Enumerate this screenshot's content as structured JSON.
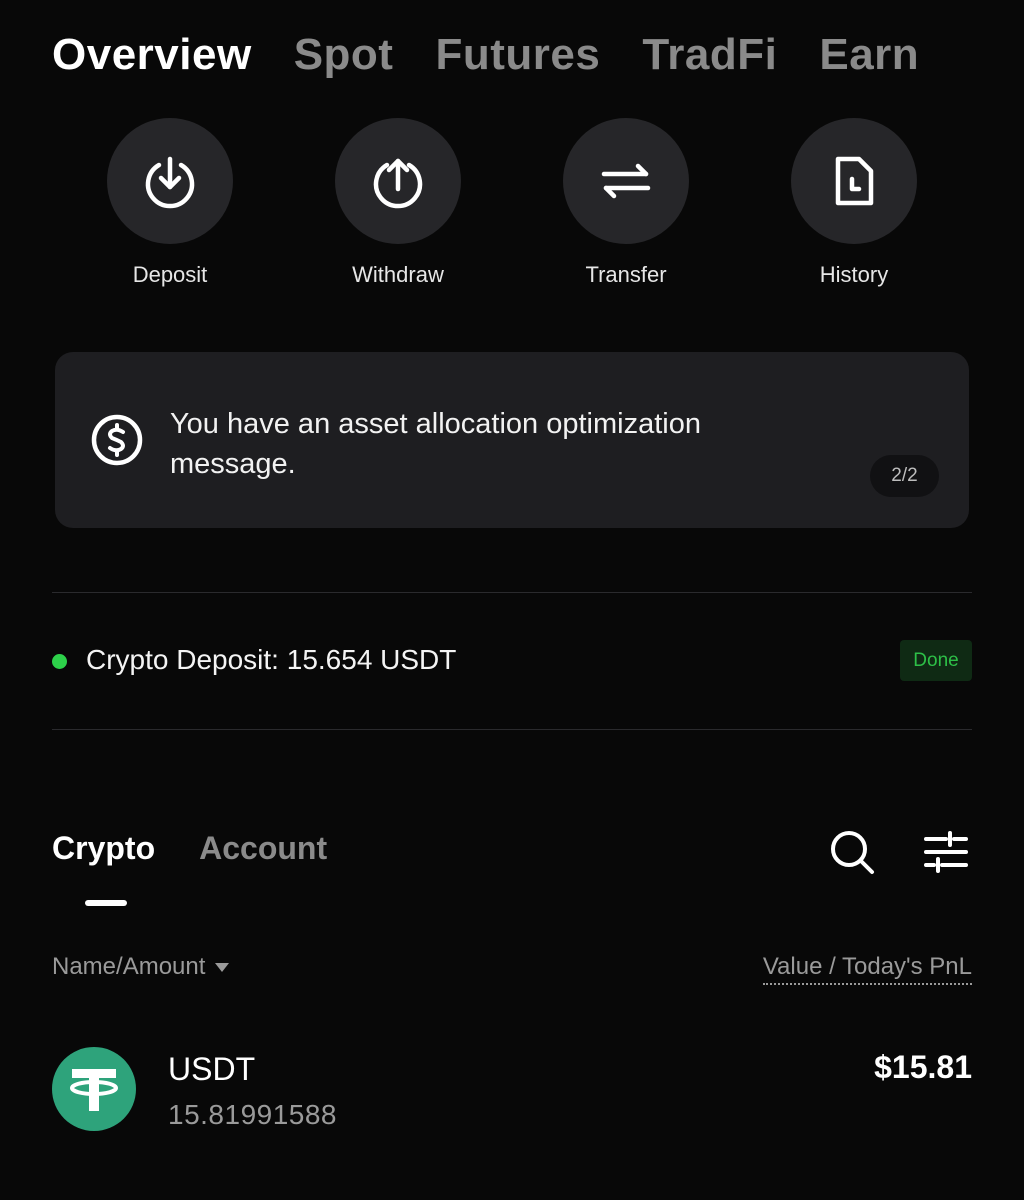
{
  "top_tabs": [
    {
      "label": "Overview",
      "active": true
    },
    {
      "label": "Spot",
      "active": false
    },
    {
      "label": "Futures",
      "active": false
    },
    {
      "label": "TradFi",
      "active": false
    },
    {
      "label": "Earn",
      "active": false
    }
  ],
  "actions": [
    {
      "label": "Deposit",
      "icon": "deposit-icon"
    },
    {
      "label": "Withdraw",
      "icon": "withdraw-icon"
    },
    {
      "label": "Transfer",
      "icon": "transfer-icon"
    },
    {
      "label": "History",
      "icon": "history-icon"
    }
  ],
  "banner": {
    "icon": "dollar-icon",
    "message": "You have an asset allocation optimization message.",
    "pager": "2/2"
  },
  "deposit_status": {
    "text": "Crypto Deposit: 15.654 USDT",
    "status": "Done",
    "dot_color": "#2dd14a"
  },
  "sub_tabs": [
    {
      "label": "Crypto",
      "active": true
    },
    {
      "label": "Account",
      "active": false
    }
  ],
  "toolbar": {
    "search_icon": "search-icon",
    "filter_icon": "filter-sliders-icon"
  },
  "columns": {
    "left": "Name/Amount",
    "right": "Value / Today's PnL"
  },
  "assets": [
    {
      "name": "USDT",
      "amount": "15.81991588",
      "value": "$15.81",
      "logo_color": "#2ea37b"
    }
  ],
  "colors": {
    "background": "#080808",
    "card": "#1e1e21",
    "accent_green": "#2dbf47"
  }
}
